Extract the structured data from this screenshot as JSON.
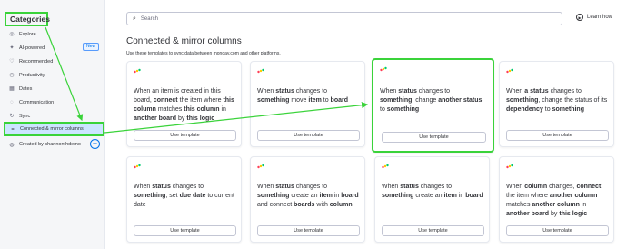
{
  "sidebar": {
    "title": "Categories",
    "items": [
      {
        "label": "Explore",
        "icon": "compass-icon"
      },
      {
        "label": "AI-powered",
        "icon": "sparkle-icon",
        "badge": "New"
      },
      {
        "label": "Recommended",
        "icon": "heart-icon"
      },
      {
        "label": "Productivity",
        "icon": "clock-icon"
      },
      {
        "label": "Dates",
        "icon": "calendar-icon"
      },
      {
        "label": "Communication",
        "icon": "chat-icon"
      },
      {
        "label": "Sync",
        "icon": "sync-icon"
      }
    ],
    "active_item": {
      "label": "Connected & mirror columns",
      "icon": "link-icon"
    },
    "created_by": {
      "label": "Created by shannonthdemo",
      "icon": "person-icon"
    }
  },
  "search": {
    "placeholder": "Search"
  },
  "learn_how": "Learn how",
  "main": {
    "title": "Connected & mirror columns",
    "subtitle": "Use these templates to sync data between monday.com and other platforms."
  },
  "use_template_label": "Use template",
  "cards": [
    {
      "segments": [
        [
          "When an item is created in this board, ",
          false
        ],
        [
          "connect",
          true
        ],
        [
          " the item where ",
          false
        ],
        [
          "this column",
          true
        ],
        [
          " matches ",
          false
        ],
        [
          "this column",
          true
        ],
        [
          " in ",
          false
        ],
        [
          "another board",
          true
        ],
        [
          " by ",
          false
        ],
        [
          "this logic",
          true
        ]
      ]
    },
    {
      "segments": [
        [
          "When ",
          false
        ],
        [
          "status",
          true
        ],
        [
          " changes to ",
          false
        ],
        [
          "something",
          true
        ],
        [
          " move ",
          false
        ],
        [
          "item",
          true
        ],
        [
          " to ",
          false
        ],
        [
          "board",
          true
        ]
      ]
    },
    {
      "segments": [
        [
          "When ",
          false
        ],
        [
          "status",
          true
        ],
        [
          " changes to ",
          false
        ],
        [
          "something",
          true
        ],
        [
          ", change ",
          false
        ],
        [
          "another status",
          true
        ],
        [
          " to ",
          false
        ],
        [
          "something",
          true
        ]
      ]
    },
    {
      "segments": [
        [
          "When ",
          false
        ],
        [
          "a status",
          true
        ],
        [
          " changes to ",
          false
        ],
        [
          "something",
          true
        ],
        [
          ", change the status of its ",
          false
        ],
        [
          "dependency",
          true
        ],
        [
          " to ",
          false
        ],
        [
          "something",
          true
        ]
      ]
    },
    {
      "segments": [
        [
          "When ",
          false
        ],
        [
          "status",
          true
        ],
        [
          " changes to ",
          false
        ],
        [
          "something",
          true
        ],
        [
          ", set ",
          false
        ],
        [
          "due date",
          true
        ],
        [
          " to ",
          false
        ],
        [
          "current date",
          false
        ]
      ]
    },
    {
      "segments": [
        [
          "When ",
          false
        ],
        [
          "status",
          true
        ],
        [
          " changes to ",
          false
        ],
        [
          "something",
          true
        ],
        [
          " create an ",
          false
        ],
        [
          "item",
          true
        ],
        [
          " in ",
          false
        ],
        [
          "board",
          true
        ],
        [
          " and connect ",
          false
        ],
        [
          "boards",
          true
        ],
        [
          " with ",
          false
        ],
        [
          "column",
          true
        ]
      ]
    },
    {
      "segments": [
        [
          "When ",
          false
        ],
        [
          "status",
          true
        ],
        [
          " changes to ",
          false
        ],
        [
          "something",
          true
        ],
        [
          " create an ",
          false
        ],
        [
          "item",
          true
        ],
        [
          " in ",
          false
        ],
        [
          "board",
          true
        ]
      ]
    },
    {
      "segments": [
        [
          "When ",
          false
        ],
        [
          "column",
          true
        ],
        [
          " changes, ",
          false
        ],
        [
          "connect",
          true
        ],
        [
          " the item where ",
          false
        ],
        [
          "another column",
          true
        ],
        [
          " matches ",
          false
        ],
        [
          "another column",
          true
        ],
        [
          " in ",
          false
        ],
        [
          "another board",
          true
        ],
        [
          " by ",
          false
        ],
        [
          "this logic",
          true
        ]
      ]
    }
  ],
  "colors": {
    "highlight": "#3ad33a",
    "active_bg": "#cce5ff",
    "accent": "#0073ea"
  }
}
